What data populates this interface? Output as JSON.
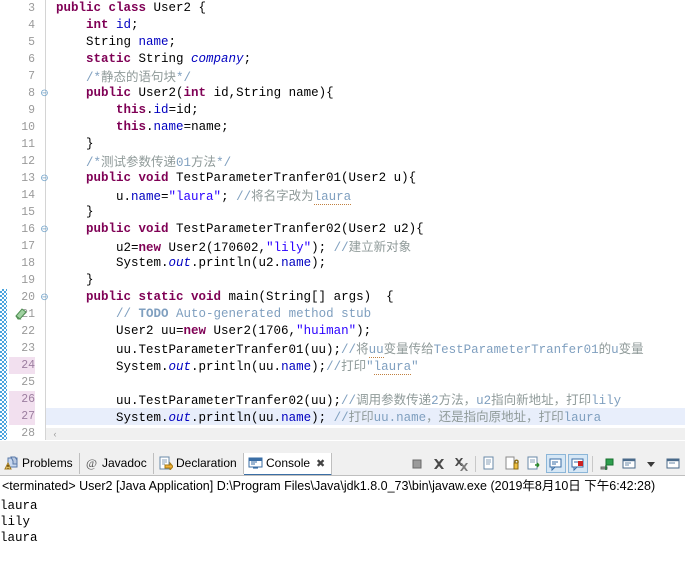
{
  "editor": {
    "first_line": 3,
    "current_line": 27,
    "marked_lines": [
      24,
      26,
      27
    ],
    "fold_lines": [
      8,
      13,
      16,
      20
    ],
    "change_bar_lines": [
      20,
      21,
      22,
      23,
      24,
      25,
      26,
      27,
      28
    ],
    "scroll_left_arrow": "‹",
    "lines": [
      {
        "n": 3,
        "tokens": [
          {
            "t": "public ",
            "c": "kw"
          },
          {
            "t": "class ",
            "c": "kw"
          },
          {
            "t": "User2 ",
            "c": "plain"
          },
          {
            "t": "{",
            "c": "plain"
          }
        ]
      },
      {
        "n": 4,
        "tokens": [
          {
            "t": "    ",
            "c": "plain"
          },
          {
            "t": "int ",
            "c": "kw"
          },
          {
            "t": "id",
            "c": "fld"
          },
          {
            "t": ";",
            "c": "plain"
          }
        ]
      },
      {
        "n": 5,
        "tokens": [
          {
            "t": "    String ",
            "c": "plain"
          },
          {
            "t": "name",
            "c": "fld"
          },
          {
            "t": ";",
            "c": "plain"
          }
        ]
      },
      {
        "n": 6,
        "tokens": [
          {
            "t": "    ",
            "c": "plain"
          },
          {
            "t": "static ",
            "c": "kw"
          },
          {
            "t": "String ",
            "c": "plain"
          },
          {
            "t": "company",
            "c": "stat"
          },
          {
            "t": ";",
            "c": "plain"
          }
        ]
      },
      {
        "n": 7,
        "tokens": [
          {
            "t": "    /*",
            "c": "cmt-blk"
          },
          {
            "t": "静态的语句块",
            "c": "cmt-cn"
          },
          {
            "t": "*/",
            "c": "cmt-blk"
          }
        ]
      },
      {
        "n": 8,
        "tokens": [
          {
            "t": "    ",
            "c": "plain"
          },
          {
            "t": "public ",
            "c": "kw"
          },
          {
            "t": "User2(",
            "c": "plain"
          },
          {
            "t": "int ",
            "c": "kw"
          },
          {
            "t": "id,String name){",
            "c": "plain"
          }
        ]
      },
      {
        "n": 9,
        "tokens": [
          {
            "t": "        ",
            "c": "plain"
          },
          {
            "t": "this",
            "c": "kw"
          },
          {
            "t": ".",
            "c": "plain"
          },
          {
            "t": "id",
            "c": "fld"
          },
          {
            "t": "=id;",
            "c": "plain"
          }
        ]
      },
      {
        "n": 10,
        "tokens": [
          {
            "t": "        ",
            "c": "plain"
          },
          {
            "t": "this",
            "c": "kw"
          },
          {
            "t": ".",
            "c": "plain"
          },
          {
            "t": "name",
            "c": "fld"
          },
          {
            "t": "=name;",
            "c": "plain"
          }
        ]
      },
      {
        "n": 11,
        "tokens": [
          {
            "t": "    }",
            "c": "plain"
          }
        ]
      },
      {
        "n": 12,
        "tokens": [
          {
            "t": "    /*",
            "c": "cmt-blk"
          },
          {
            "t": "测试参数传递",
            "c": "cmt-cn"
          },
          {
            "t": "01",
            "c": "cmt-blk"
          },
          {
            "t": "方法",
            "c": "cmt-cn"
          },
          {
            "t": "*/",
            "c": "cmt-blk"
          }
        ]
      },
      {
        "n": 13,
        "tokens": [
          {
            "t": "    ",
            "c": "plain"
          },
          {
            "t": "public void ",
            "c": "kw"
          },
          {
            "t": "TestParameterTranfer01(User2 u){",
            "c": "plain"
          }
        ]
      },
      {
        "n": 14,
        "tokens": [
          {
            "t": "        u.",
            "c": "plain"
          },
          {
            "t": "name",
            "c": "fld"
          },
          {
            "t": "=",
            "c": "plain"
          },
          {
            "t": "\"laura\"",
            "c": "str"
          },
          {
            "t": "; ",
            "c": "plain"
          },
          {
            "t": "//",
            "c": "cmt-blk"
          },
          {
            "t": "将名字改为",
            "c": "cmt-cn"
          },
          {
            "t": "laura",
            "c": "cmt-blk spell"
          }
        ]
      },
      {
        "n": 15,
        "tokens": [
          {
            "t": "    }",
            "c": "plain"
          }
        ]
      },
      {
        "n": 16,
        "tokens": [
          {
            "t": "    ",
            "c": "plain"
          },
          {
            "t": "public void ",
            "c": "kw"
          },
          {
            "t": "TestParameterTranfer02(User2 u2){",
            "c": "plain"
          }
        ]
      },
      {
        "n": 17,
        "tokens": [
          {
            "t": "        u2=",
            "c": "plain"
          },
          {
            "t": "new ",
            "c": "kw"
          },
          {
            "t": "User2(170602,",
            "c": "plain"
          },
          {
            "t": "\"lily\"",
            "c": "str"
          },
          {
            "t": "); ",
            "c": "plain"
          },
          {
            "t": "//",
            "c": "cmt-blk"
          },
          {
            "t": "建立新对象",
            "c": "cmt-cn"
          }
        ]
      },
      {
        "n": 18,
        "tokens": [
          {
            "t": "        System.",
            "c": "plain"
          },
          {
            "t": "out",
            "c": "stat"
          },
          {
            "t": ".println(u2.",
            "c": "plain"
          },
          {
            "t": "name",
            "c": "fld"
          },
          {
            "t": ");",
            "c": "plain"
          }
        ]
      },
      {
        "n": 19,
        "tokens": [
          {
            "t": "    }",
            "c": "plain"
          }
        ]
      },
      {
        "n": 20,
        "tokens": [
          {
            "t": "    ",
            "c": "plain"
          },
          {
            "t": "public static void ",
            "c": "kw"
          },
          {
            "t": "main(String[] args)  {",
            "c": "plain"
          }
        ]
      },
      {
        "n": 21,
        "tokens": [
          {
            "t": "        ",
            "c": "plain"
          },
          {
            "t": "// ",
            "c": "cmt-blk"
          },
          {
            "t": "TODO",
            "c": "todo"
          },
          {
            "t": " Auto-generated method stub",
            "c": "cmt-blk"
          }
        ]
      },
      {
        "n": 22,
        "tokens": [
          {
            "t": "        User2 uu=",
            "c": "plain"
          },
          {
            "t": "new ",
            "c": "kw"
          },
          {
            "t": "User2(1706,",
            "c": "plain"
          },
          {
            "t": "\"huiman\"",
            "c": "str"
          },
          {
            "t": ");",
            "c": "plain"
          }
        ]
      },
      {
        "n": 23,
        "tokens": [
          {
            "t": "        uu.TestParameterTranfer01(uu);",
            "c": "plain"
          },
          {
            "t": "//",
            "c": "cmt-blk"
          },
          {
            "t": "将",
            "c": "cmt-cn"
          },
          {
            "t": "uu",
            "c": "cmt-blk spell"
          },
          {
            "t": "变量传给",
            "c": "cmt-cn"
          },
          {
            "t": "TestParameterTranfer01",
            "c": "cmt-blk"
          },
          {
            "t": "的",
            "c": "cmt-cn"
          },
          {
            "t": "u",
            "c": "cmt-blk"
          },
          {
            "t": "变量",
            "c": "cmt-cn"
          }
        ]
      },
      {
        "n": 24,
        "tokens": [
          {
            "t": "        System.",
            "c": "plain"
          },
          {
            "t": "out",
            "c": "stat"
          },
          {
            "t": ".println(uu.",
            "c": "plain"
          },
          {
            "t": "name",
            "c": "fld"
          },
          {
            "t": ");",
            "c": "plain"
          },
          {
            "t": "//",
            "c": "cmt-blk"
          },
          {
            "t": "打印",
            "c": "cmt-cn"
          },
          {
            "t": "\"",
            "c": "cmt-blk"
          },
          {
            "t": "laura",
            "c": "cmt-blk spell"
          },
          {
            "t": "\"",
            "c": "cmt-blk"
          }
        ]
      },
      {
        "n": 25,
        "tokens": [
          {
            "t": "",
            "c": "plain"
          }
        ]
      },
      {
        "n": 26,
        "tokens": [
          {
            "t": "        uu.TestParameterTranfer02(uu);",
            "c": "plain"
          },
          {
            "t": "//",
            "c": "cmt-blk"
          },
          {
            "t": "调用参数传递",
            "c": "cmt-cn"
          },
          {
            "t": "2",
            "c": "cmt-blk"
          },
          {
            "t": "方法，",
            "c": "cmt-cn"
          },
          {
            "t": "u2",
            "c": "cmt-blk"
          },
          {
            "t": "指向新地址，打印",
            "c": "cmt-cn"
          },
          {
            "t": "lily",
            "c": "cmt-blk"
          }
        ]
      },
      {
        "n": 27,
        "tokens": [
          {
            "t": "        System.",
            "c": "plain"
          },
          {
            "t": "out",
            "c": "stat"
          },
          {
            "t": ".println(uu.",
            "c": "plain"
          },
          {
            "t": "name",
            "c": "fld"
          },
          {
            "t": "); ",
            "c": "plain"
          },
          {
            "t": "//",
            "c": "cmt-blk"
          },
          {
            "t": "打印",
            "c": "cmt-cn"
          },
          {
            "t": "uu.name",
            "c": "cmt-blk"
          },
          {
            "t": "，还是指向原地址，打印",
            "c": "cmt-cn"
          },
          {
            "t": "laura",
            "c": "cmt-blk spell"
          }
        ]
      },
      {
        "n": 28,
        "tokens": [
          {
            "t": "    }",
            "c": "plain"
          }
        ]
      }
    ]
  },
  "bottom": {
    "tabs": [
      {
        "label": "Problems",
        "icon": "problems-icon",
        "active": false,
        "closable": false
      },
      {
        "label": "Javadoc",
        "icon": "javadoc-icon",
        "active": false,
        "closable": false
      },
      {
        "label": "Declaration",
        "icon": "declaration-icon",
        "active": false,
        "closable": false
      },
      {
        "label": "Console",
        "icon": "console-icon",
        "active": true,
        "closable": true,
        "close_glyph": "✖"
      }
    ],
    "toolbar": [
      {
        "name": "terminate-button",
        "selected": false
      },
      {
        "name": "remove-launch-button",
        "selected": false
      },
      {
        "name": "remove-all-terminated-button",
        "selected": false
      },
      {
        "name": "separator",
        "selected": false
      },
      {
        "name": "clear-console-button",
        "selected": false
      },
      {
        "name": "scroll-lock-button",
        "selected": false
      },
      {
        "name": "word-wrap-button",
        "selected": false
      },
      {
        "name": "show-console-on-output-button",
        "selected": true
      },
      {
        "name": "show-console-on-error-button",
        "selected": true
      },
      {
        "name": "separator",
        "selected": false
      },
      {
        "name": "pin-console-button",
        "selected": false
      },
      {
        "name": "display-selected-console-button",
        "selected": false
      },
      {
        "name": "display-selected-console-dropdown",
        "selected": false
      },
      {
        "name": "open-console-button",
        "selected": false
      }
    ],
    "console_header": "<terminated> User2 [Java Application] D:\\Program Files\\Java\\jdk1.8.0_73\\bin\\javaw.exe (2019年8月10日 下午6:42:28)",
    "console_output": [
      "laura",
      "lily",
      "laura"
    ]
  },
  "colors": {
    "keyword": "#7f0055",
    "field": "#0000c0",
    "string": "#2a00ff",
    "comment": "#7f9fbf",
    "comment_cn": "#8f9a99",
    "line_number": "#9a9a9a",
    "marked_line_bg": "#f2e0ef",
    "current_line_bg": "#e8eefb",
    "change_bar": "#4aa3dd",
    "tab_active_underline": "#3a6ea5"
  }
}
